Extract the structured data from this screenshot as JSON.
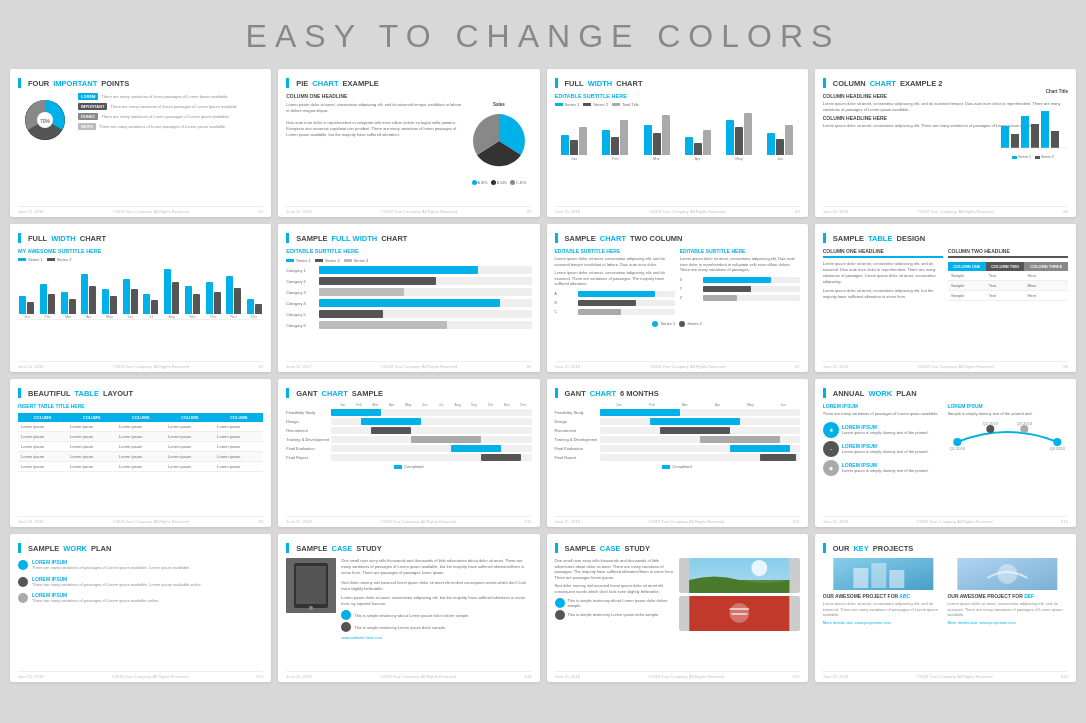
{
  "page": {
    "main_title": "EASY TO CHANGE COLORS",
    "accent_color": "#00b0e8",
    "dark_color": "#333333",
    "gray_color": "#888888"
  },
  "slides": [
    {
      "id": "s1",
      "title_plain": "FOUR ",
      "title_accent": "IMPORTANT",
      "title_rest": " POINTS",
      "subtitle": "",
      "type": "four_points",
      "footer_left": "June 15, 2018",
      "footer_right": "©2018 Your Company. All Rights Reserved",
      "footer_num": "S1"
    },
    {
      "id": "s2",
      "title_plain": "PIE ",
      "title_accent": "CHART",
      "title_rest": " EXAMPLE",
      "type": "pie_chart",
      "footer_left": "June 15, 2018",
      "footer_right": "©2018 Your Company. All Rights Reserved",
      "footer_num": "S2"
    },
    {
      "id": "s3",
      "title_plain": "FULL ",
      "title_accent": "WIDTH",
      "title_rest": " CHART",
      "subtitle": "EDITABLE SUBTITLE HERE",
      "type": "full_width_chart",
      "footer_left": "June 15, 2018",
      "footer_right": "©2018 Your Company. All Rights Reserved",
      "footer_num": "S3"
    },
    {
      "id": "s4",
      "title_plain": "COLUMN ",
      "title_accent": "CHART",
      "title_rest": " EXAMPLE 2",
      "type": "column_chart2",
      "footer_left": "June 15, 2018",
      "footer_right": "©2018 Your Company. All Rights Reserved",
      "footer_num": "S4"
    },
    {
      "id": "s5",
      "title_plain": "FULL ",
      "title_accent": "WIDTH",
      "title_rest": " CHART",
      "subtitle": "MY AWESOME SUBTITLE HERE",
      "type": "full_width_chart2",
      "footer_left": "June 15, 2018",
      "footer_right": "©2018 Your Company. All Rights Reserved",
      "footer_num": "S5"
    },
    {
      "id": "s6",
      "title_plain": "SAMPLE ",
      "title_accent": "FULL WIDTH",
      "title_rest": " CHART",
      "subtitle": "EDITABLE SUBTITLE HERE",
      "type": "sample_full_width",
      "footer_left": "June 15, 2017",
      "footer_right": "©2018 Your Company. All Rights Reserved",
      "footer_num": "S6"
    },
    {
      "id": "s7",
      "title_plain": "SAMPLE ",
      "title_accent": "CHART",
      "title_rest": " TWO COLUMN",
      "subtitle": "EDITABLE SUBTITLE HERE",
      "type": "chart_two_col",
      "footer_left": "June 15, 2018",
      "footer_right": "©2018 Your Company. All Rights Reserved",
      "footer_num": "S7"
    },
    {
      "id": "s8",
      "title_plain": "SAMPLE ",
      "title_accent": "TABLE",
      "title_rest": " DESIGN",
      "type": "table_design",
      "col1": "COLUMN ONE",
      "col2": "COLUMN TWO",
      "col3": "COLUMN THREE",
      "footer_left": "June 15, 2018",
      "footer_right": "©2018 Your Company. All Rights Reserved",
      "footer_num": "S8"
    },
    {
      "id": "s9",
      "title_plain": "BEAUTIFUL ",
      "title_accent": "TABLE",
      "title_rest": " LAYOUT",
      "type": "table_layout",
      "table_title": "INSERT TABLE TITLE HERE",
      "footer_left": "June 15, 2018",
      "footer_right": "©2018 Your Company. All Rights Reserved",
      "footer_num": "S9"
    },
    {
      "id": "s10",
      "title_plain": "GANT ",
      "title_accent": "CHART",
      "title_rest": " SAMPLE",
      "type": "gantt_sample",
      "footer_left": "June 15, 2018",
      "footer_right": "©2018 Your Company. All Rights Reserved",
      "footer_num": "S10"
    },
    {
      "id": "s11",
      "title_plain": "GANT ",
      "title_accent": "CHART",
      "title_rest": " 6 MONTHS",
      "type": "gantt_6months",
      "footer_left": "June 15, 2018",
      "footer_right": "©2018 Your Company. All Rights Reserved",
      "footer_num": "S11"
    },
    {
      "id": "s12",
      "title_plain": "ANNUAL ",
      "title_accent": "WORK",
      "title_rest": " PLAN",
      "type": "annual_work",
      "footer_left": "June 15, 2018",
      "footer_right": "©2018 Your Company. All Rights Reserved",
      "footer_num": "S12"
    },
    {
      "id": "s13",
      "title_plain": "SAMPLE ",
      "title_accent": "WORK",
      "title_rest": " PLAN",
      "type": "work_plan",
      "footer_left": "June 15, 2018",
      "footer_right": "©2018 Your Company. All Rights Reserved",
      "footer_num": "S13"
    },
    {
      "id": "s14",
      "title_plain": "SAMPLE ",
      "title_accent": "CASE",
      "title_rest": " STUDY",
      "type": "case_study1",
      "footer_left": "June 15, 2018",
      "footer_right": "©2018 Your Company. All Rights Reserved",
      "footer_num": "S14"
    },
    {
      "id": "s15",
      "title_plain": "SAMPLE ",
      "title_accent": "CASE",
      "title_rest": " STUDY",
      "type": "case_study2",
      "footer_left": "June 15, 2018",
      "footer_right": "©2018 Your Company. All Rights Reserved",
      "footer_num": "S15"
    },
    {
      "id": "s16",
      "title_plain": "OUR ",
      "title_accent": "KEY",
      "title_rest": " PROJECTS",
      "type": "key_projects",
      "footer_left": "June 15, 2018",
      "footer_right": "©2018 Your Company. All Rights Reserved",
      "footer_num": "S16"
    }
  ]
}
